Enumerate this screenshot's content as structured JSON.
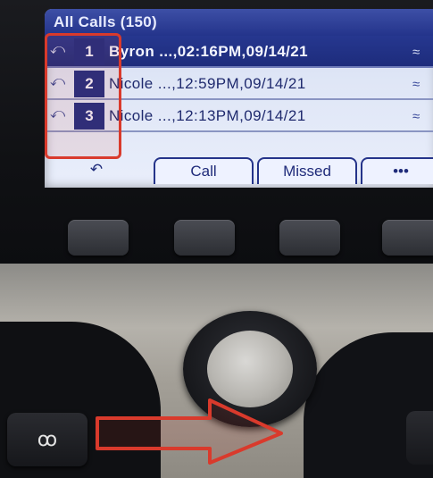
{
  "screen": {
    "title": "All Calls (150)",
    "calls": [
      {
        "index": "1",
        "entry": "Byron ...,02:16PM,09/14/21",
        "selected": true
      },
      {
        "index": "2",
        "entry": "Nicole ...,12:59PM,09/14/21",
        "selected": false
      },
      {
        "index": "3",
        "entry": "Nicole ...,12:13PM,09/14/21",
        "selected": false
      }
    ],
    "softkeys": {
      "back_icon": "↶",
      "call": "Call",
      "missed": "Missed",
      "more": "•••"
    }
  },
  "icons": {
    "received_call": "⤺",
    "line": "≈",
    "voicemail": "ꝏ"
  },
  "colors": {
    "highlight": "#d93a2c",
    "lcd_title": "#24348b"
  }
}
